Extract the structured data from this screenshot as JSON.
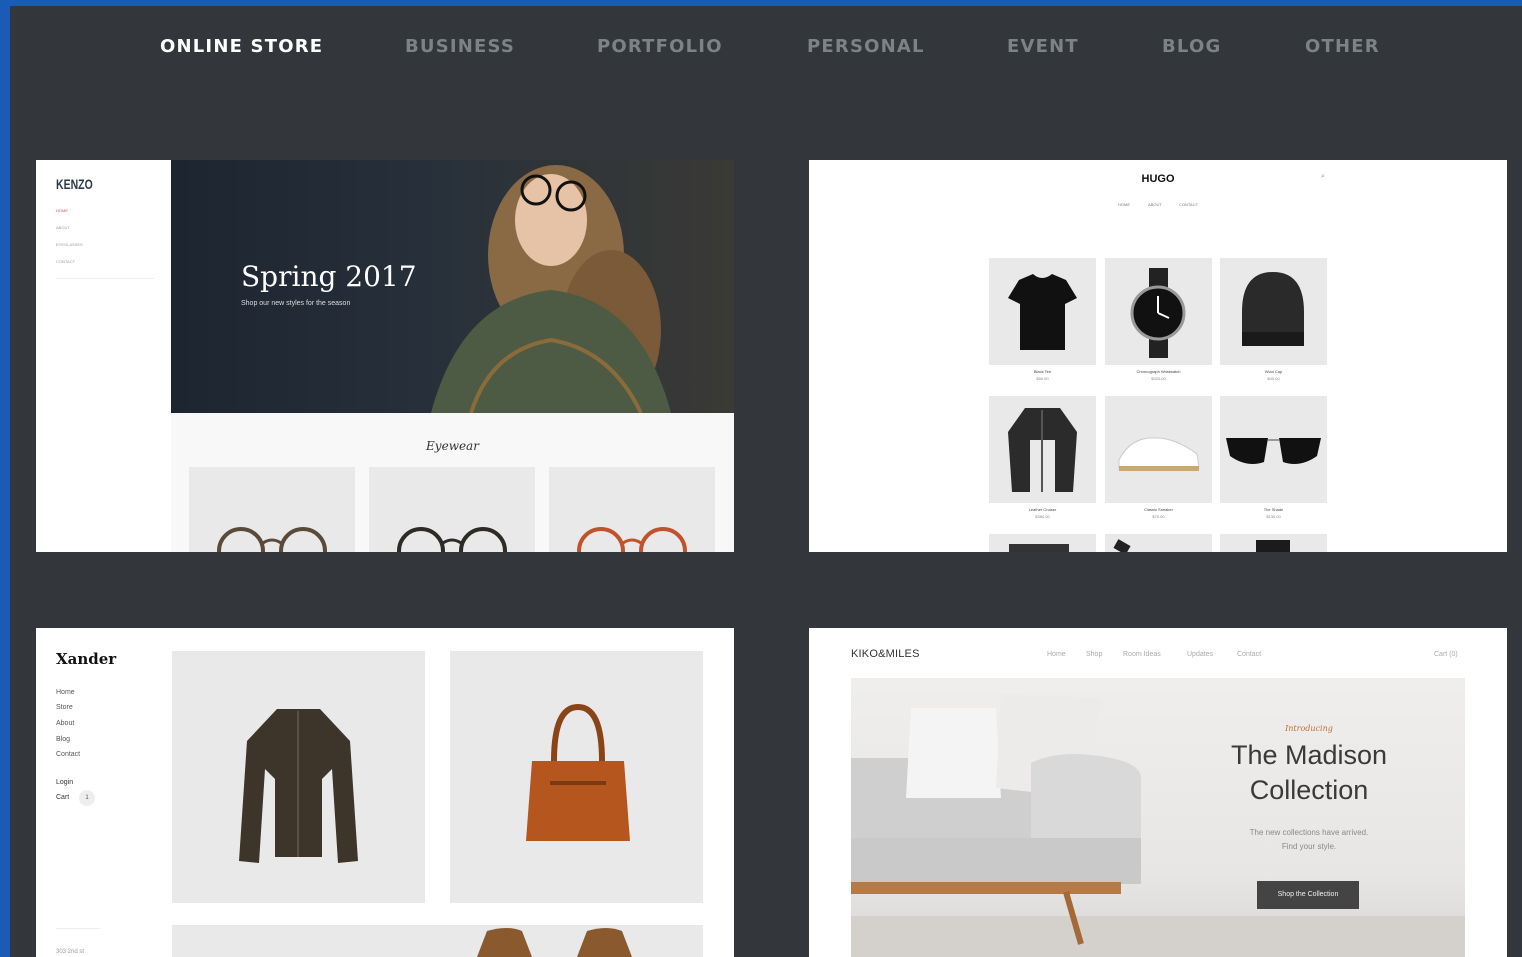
{
  "nav": {
    "tabs": [
      {
        "label": "ONLINE STORE",
        "active": true
      },
      {
        "label": "BUSINESS",
        "active": false
      },
      {
        "label": "PORTFOLIO",
        "active": false
      },
      {
        "label": "PERSONAL",
        "active": false
      },
      {
        "label": "EVENT",
        "active": false
      },
      {
        "label": "BLOG",
        "active": false
      },
      {
        "label": "OTHER",
        "active": false
      }
    ]
  },
  "kenzo": {
    "logo": "KENZO",
    "menu": [
      "HOME",
      "ABOUT",
      "EYEGLASSES",
      "CONTACT"
    ],
    "hero_title": "Spring 2017",
    "hero_sub": "Shop our new styles for the season",
    "section_title": "Eyewear"
  },
  "hugo": {
    "logo": "HUGO",
    "menu": [
      "HOME",
      "ABOUT",
      "CONTACT"
    ],
    "products": [
      {
        "name": "Black Tee",
        "price": "$50.00"
      },
      {
        "name": "Chronograph Wristwatch",
        "price": "$320.00"
      },
      {
        "name": "Wool Cap",
        "price": "$45.00"
      },
      {
        "name": "Leather Cruiser",
        "price": "$380.00"
      },
      {
        "name": "Classic Sneaker",
        "price": "$75.00"
      },
      {
        "name": "The Shade",
        "price": "$130.00"
      }
    ]
  },
  "xander": {
    "logo": "Xander",
    "menu": [
      "Home",
      "Store",
      "About",
      "Blog",
      "Contact"
    ],
    "login": "Login",
    "cart": "Cart",
    "cart_count": "1",
    "address": "303 2nd st"
  },
  "kiko": {
    "logo": "KIKO&MILES",
    "menu": [
      "Home",
      "Shop",
      "Room Ideas",
      "Updates",
      "Contact"
    ],
    "cart": "Cart (0)",
    "intro": "Introducing",
    "title_line1": "The Madison",
    "title_line2": "Collection",
    "desc_line1": "The new collections have arrived.",
    "desc_line2": "Find your style.",
    "cta": "Shop the Collection"
  }
}
